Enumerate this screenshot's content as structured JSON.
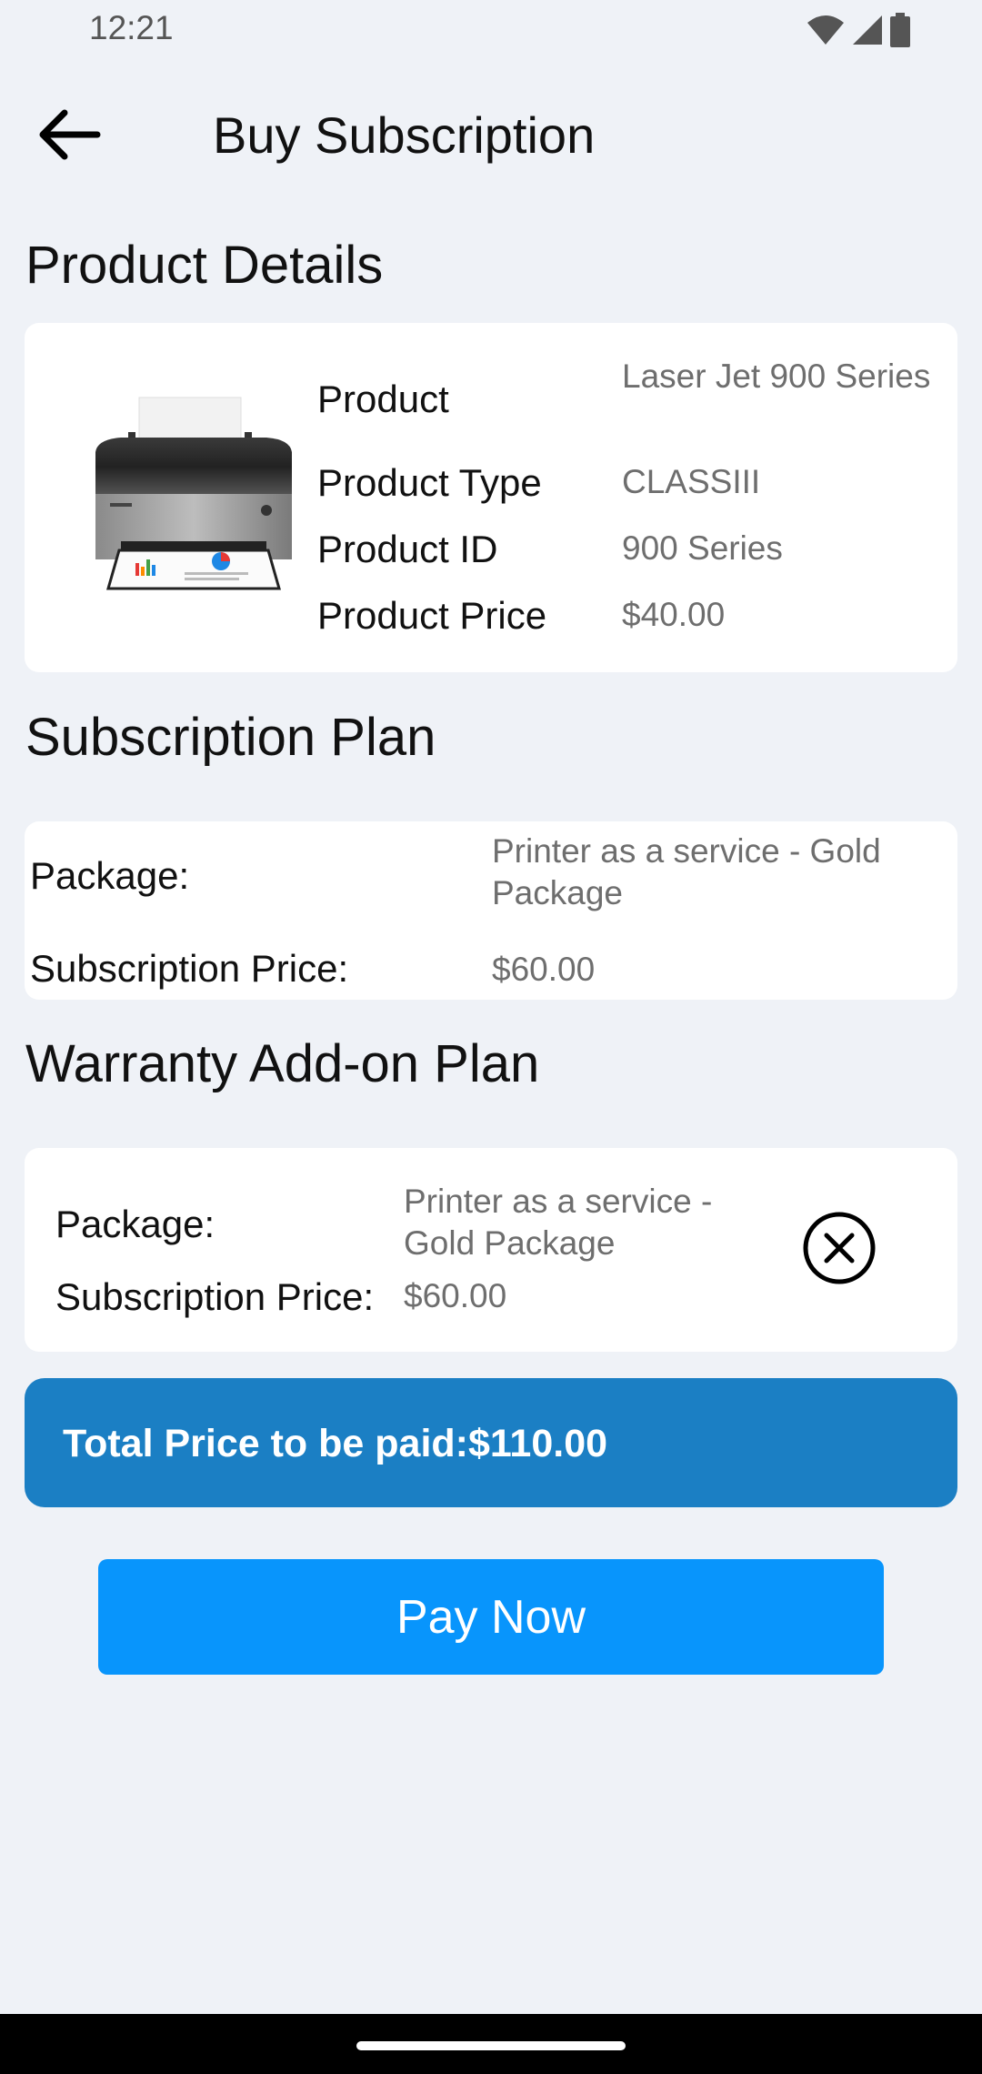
{
  "status_bar": {
    "time": "12:21",
    "icons": [
      "wifi-icon",
      "signal-icon",
      "battery-icon"
    ]
  },
  "app_bar": {
    "back_icon": "arrow-left-icon",
    "title": "Buy Subscription"
  },
  "product_details": {
    "section_title": "Product Details",
    "image": "printer-image",
    "rows": [
      {
        "label": "Product",
        "value": "Laser Jet 900 Series"
      },
      {
        "label": "Product Type",
        "value": "CLASSIII"
      },
      {
        "label": "Product ID",
        "value": "900 Series"
      },
      {
        "label": "Product Price",
        "value": "$40.00"
      }
    ]
  },
  "subscription_plan": {
    "section_title": "Subscription Plan",
    "package_label": "Package:",
    "package_value": "Printer as a service - Gold Package",
    "price_label": "Subscription Price:",
    "price_value": "$60.00"
  },
  "warranty_plan": {
    "section_title": "Warranty Add-on Plan",
    "package_label": "Package:",
    "package_value": "Printer as a service - Gold Package",
    "price_label": "Subscription Price:",
    "price_value": "$60.00",
    "remove_icon": "close-circle-icon"
  },
  "total": {
    "text": "Total Price to be paid:$110.00"
  },
  "pay_button": {
    "label": "Pay Now"
  },
  "colors": {
    "background": "#eff2f7",
    "card": "#ffffff",
    "total_bar": "#1b7fc4",
    "pay_button": "#0895fc",
    "value_text": "#6e6e6e"
  }
}
